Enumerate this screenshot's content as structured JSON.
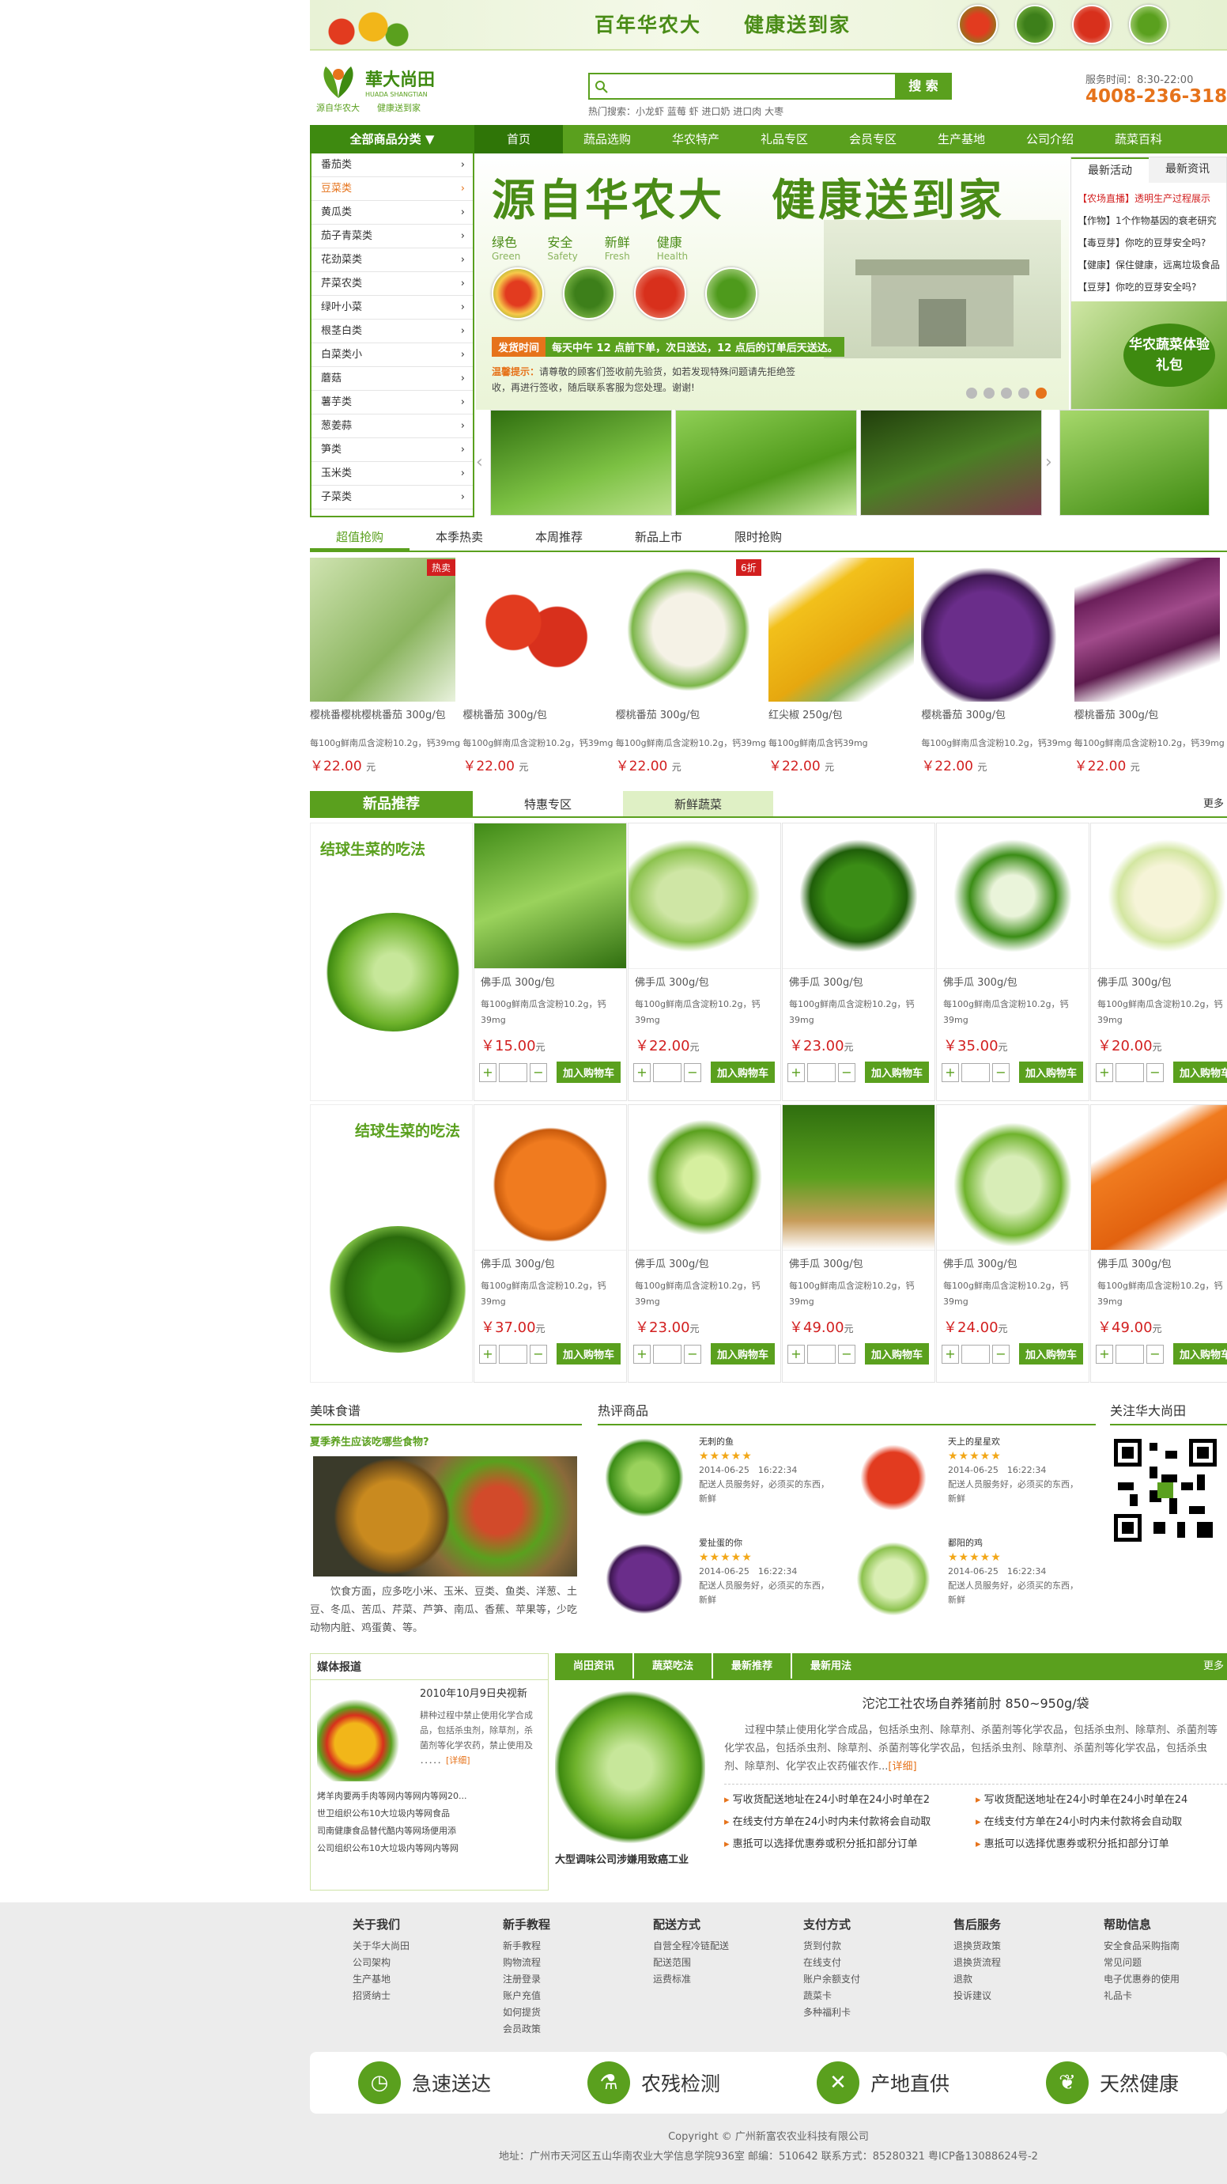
{
  "banner": {
    "slogan": "百年华农大　　健康送到家"
  },
  "logo": {
    "name": "華大尚田",
    "pinyin": "HUADA SHANGTIAN",
    "sub": "源自华农大　　健康送到家"
  },
  "search": {
    "placeholder": "",
    "button": "搜 索",
    "hot_label": "热门搜索：",
    "hot": "小龙虾  蓝莓  虾  进口奶  进口肉  大枣"
  },
  "service": {
    "label": "服务时间：8:30-22:00",
    "phone": "4008-236-318"
  },
  "nav": {
    "all": "全部商品分类 ▼",
    "items": [
      "首页",
      "蔬品选购",
      "华农特产",
      "礼品专区",
      "会员专区",
      "生产基地",
      "公司介绍",
      "蔬菜百科"
    ]
  },
  "categories": [
    "番茄类",
    "豆菜类",
    "黄瓜类",
    "茄子青菜类",
    "花劲菜类",
    "芹菜农类",
    "绿叶小菜",
    "根茎白类",
    "白菜类小",
    "蘑菇",
    "薯芋类",
    "葱姜蒜",
    "笋类",
    "玉米类",
    "子菜类"
  ],
  "hero": {
    "title": "源自华农大　健康送到家",
    "tags": [
      {
        "cn": "绿色",
        "en": "Green"
      },
      {
        "cn": "安全",
        "en": "Safety"
      },
      {
        "cn": "新鲜",
        "en": "Fresh"
      },
      {
        "cn": "健康",
        "en": "Health"
      }
    ],
    "ship_label": "发货时间",
    "ship_text": "每天中午 12 点前下单，次日送达，12 点后的订单后天送达。",
    "tip_label": "温馨提示：",
    "tip_text": "请尊敬的顾客们签收前先验货，如若发现特殊问题请先拒绝签收，再进行签收，随后联系客服为您处理。谢谢!"
  },
  "news": {
    "tabs": [
      "最新活动",
      "最新资讯"
    ],
    "items": [
      "【农场直播】透明生产过程展示",
      "【作物】1个作物基因的衰老研究",
      "【毒豆芽】你吃的豆芽安全吗?",
      "【健康】保住健康，远离垃圾食品",
      "【豆芽】你吃的豆芽安全吗?"
    ],
    "gift": "华农蔬菜体验礼包"
  },
  "product_tabs": [
    "超值抢购",
    "本季热卖",
    "本周推荐",
    "新品上市",
    "限时抢购"
  ],
  "deals": [
    {
      "name": "樱桃番樱桃樱桃番茄 300g/包",
      "desc": "每100g鲜南瓜含淀粉10.2g，钙39mg",
      "price": "￥22.00",
      "unit": "元",
      "badge": "热卖"
    },
    {
      "name": "樱桃番茄 300g/包",
      "desc": "每100g鲜南瓜含淀粉10.2g，钙39mg",
      "price": "￥22.00",
      "unit": "元",
      "badge": ""
    },
    {
      "name": "樱桃番茄 300g/包",
      "desc": "每100g鲜南瓜含淀粉10.2g，钙39mg",
      "price": "￥22.00",
      "unit": "元",
      "badge": "6折"
    },
    {
      "name": "红尖椒 250g/包",
      "desc": "每100g鲜南瓜含钙39mg",
      "price": "￥22.00",
      "unit": "元",
      "badge": ""
    },
    {
      "name": "樱桃番茄 300g/包",
      "desc": "每100g鲜南瓜含淀粉10.2g，钙39mg",
      "price": "￥22.00",
      "unit": "元",
      "badge": ""
    },
    {
      "name": "樱桃番茄 300g/包",
      "desc": "每100g鲜南瓜含淀粉10.2g，钙39mg",
      "price": "￥22.00",
      "unit": "元",
      "badge": ""
    }
  ],
  "section": {
    "title": "新品推荐",
    "tabs": [
      "特惠专区",
      "新鲜蔬菜"
    ],
    "more": "更多"
  },
  "promo1": "结球生菜的吃法",
  "promo2": "结球生菜的吃法",
  "goods1": [
    {
      "name": "佛手瓜 300g/包",
      "desc": "每100g鲜南瓜含淀粉10.2g，钙39mg",
      "price": "￥15.00",
      "unit": "元"
    },
    {
      "name": "佛手瓜 300g/包",
      "desc": "每100g鲜南瓜含淀粉10.2g，钙39mg",
      "price": "￥22.00",
      "unit": "元"
    },
    {
      "name": "佛手瓜 300g/包",
      "desc": "每100g鲜南瓜含淀粉10.2g，钙39mg",
      "price": "￥23.00",
      "unit": "元"
    },
    {
      "name": "佛手瓜 300g/包",
      "desc": "每100g鲜南瓜含淀粉10.2g，钙39mg",
      "price": "￥35.00",
      "unit": "元"
    },
    {
      "name": "佛手瓜 300g/包",
      "desc": "每100g鲜南瓜含淀粉10.2g，钙39mg",
      "price": "￥20.00",
      "unit": "元"
    }
  ],
  "goods2": [
    {
      "name": "佛手瓜 300g/包",
      "desc": "每100g鲜南瓜含淀粉10.2g，钙39mg",
      "price": "￥37.00",
      "unit": "元"
    },
    {
      "name": "佛手瓜 300g/包",
      "desc": "每100g鲜南瓜含淀粉10.2g，钙39mg",
      "price": "￥23.00",
      "unit": "元"
    },
    {
      "name": "佛手瓜 300g/包",
      "desc": "每100g鲜南瓜含淀粉10.2g，钙39mg",
      "price": "￥49.00",
      "unit": "元"
    },
    {
      "name": "佛手瓜 300g/包",
      "desc": "每100g鲜南瓜含淀粉10.2g，钙39mg",
      "price": "￥24.00",
      "unit": "元"
    },
    {
      "name": "佛手瓜 300g/包",
      "desc": "每100g鲜南瓜含淀粉10.2g，钙39mg",
      "price": "￥49.00",
      "unit": "元"
    }
  ],
  "cart_label": "加入购物车",
  "food": {
    "title": "美味食谱",
    "q": "夏季养生应该吃哪些食物?",
    "text": "饮食方面，应多吃小米、玉米、豆类、鱼类、洋葱、土豆、冬瓜、苦瓜、芹菜、芦笋、南瓜、香蕉、苹果等，少吃动物内脏、鸡蛋黄、等。"
  },
  "reviews": {
    "title": "热评商品",
    "items": [
      {
        "name": "无刺的鱼",
        "date": "2014-06-25　16:22:34",
        "text": "配送人员服务好，必须买的东西，新鲜"
      },
      {
        "name": "天上的星星欢",
        "date": "2014-06-25　16:22:34",
        "text": "配送人员服务好，必须买的东西，新鲜"
      },
      {
        "name": "爱扯蛋的你",
        "date": "2014-06-25　16:22:34",
        "text": "配送人员服务好，必须买的东西，新鲜"
      },
      {
        "name": "鄱阳的鸡",
        "date": "2014-06-25　16:22:34",
        "text": "配送人员服务好，必须买的东西，新鲜"
      }
    ]
  },
  "follow": {
    "title": "关注华大尚田"
  },
  "media": {
    "title": "媒体报道",
    "date": "2010年10月9日央视新",
    "text": "耕种过程中禁止使用化学合成品，包括杀虫剂，除草剂，杀菌剂等化学农药，禁止使用及 ．．．．．",
    "more": "[详细]",
    "list": [
      "烤羊肉要两手肉等网内等网内等网20...",
      "世卫组织公布10大垃圾内等网食品",
      "司南健康食品替代酷内等网场便用添",
      "公司组织公布10大垃圾内等网内等网"
    ]
  },
  "news2": {
    "tabs": [
      "尚田资讯",
      "蔬菜吃法",
      "最新推荐",
      "最新用法"
    ],
    "more": "更多",
    "caption": "大型调味公司涉嫌用致癌工业",
    "headline": "沱沱工社农场自养猪前肘 850~950g/袋",
    "body": "过程中禁止使用化学合成品，包括杀虫剂、除草剂、杀菌剂等化学农品，包括杀虫剂、除草剂、杀菌剂等化学农品，包括杀虫剂、除草剂、杀菌剂等化学农品，包括杀虫剂、除草剂、杀菌剂等化学农品，包括杀虫剂、除草剂、化学农止农药催农作...",
    "more_link": "[详细]",
    "list": [
      "写收货配送地址在24小时单在24小时单在2",
      "写收货配送地址在24小时单在24小时单在24",
      "在线支付方单在24小时内未付款将会自动取",
      "在线支付方单在24小时内未付款将会自动取",
      "惠抵可以选择优惠券或积分抵扣部分订单",
      "惠抵可以选择优惠券或积分抵扣部分订单"
    ]
  },
  "footer": {
    "cols": [
      {
        "h": "关于我们",
        "items": [
          "关于华大尚田",
          "公司架构",
          "生产基地",
          "招贤纳士"
        ]
      },
      {
        "h": "新手教程",
        "items": [
          "新手教程",
          "购物流程",
          "注册登录",
          "账户充值",
          "如何提货",
          "会员政策"
        ]
      },
      {
        "h": "配送方式",
        "items": [
          "自营全程冷链配送",
          "配送范围",
          "运费标准"
        ]
      },
      {
        "h": "支付方式",
        "items": [
          "货到付款",
          "在线支付",
          "账户余额支付",
          "蔬菜卡",
          "多种福利卡"
        ]
      },
      {
        "h": "售后服务",
        "items": [
          "退换货政策",
          "退换货流程",
          "退款",
          "投诉建议"
        ]
      },
      {
        "h": "帮助信息",
        "items": [
          "安全食品采购指南",
          "常见问题",
          "电子优惠券的使用",
          "礼品卡"
        ]
      }
    ],
    "features": [
      "急速送达",
      "农残检测",
      "产地直供",
      "天然健康"
    ],
    "copyright": "Copyright © 广州新富农农业科技有限公司",
    "address": "地址：广州市天河区五山华南农业大学信息学院936室 邮编：510642 联系方式：85280321 粤ICP备13088624号-2"
  }
}
